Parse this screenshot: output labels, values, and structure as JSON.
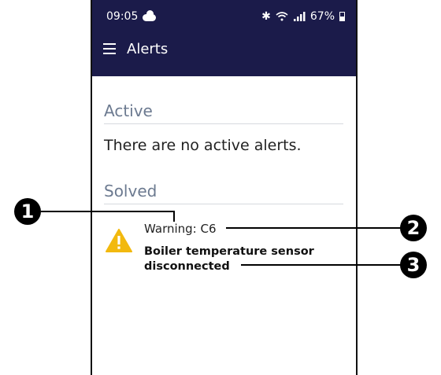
{
  "status_bar": {
    "time": "09:05",
    "icons": [
      "cloud-icon",
      "bluetooth-icon",
      "wifi-icon",
      "signal-icon",
      "battery-icon"
    ],
    "battery": "67%"
  },
  "appbar": {
    "title": "Alerts",
    "color": "#1b1b4a"
  },
  "sections": {
    "active": {
      "heading": "Active",
      "empty_message": "There are no active alerts."
    },
    "solved": {
      "heading": "Solved",
      "alert": {
        "title": "Warning: C6",
        "description": "Boiler temperature sensor disconnected",
        "icon": "warning-icon",
        "icon_color": "#f2b90f"
      }
    }
  },
  "callouts": [
    "1",
    "2",
    "3"
  ]
}
